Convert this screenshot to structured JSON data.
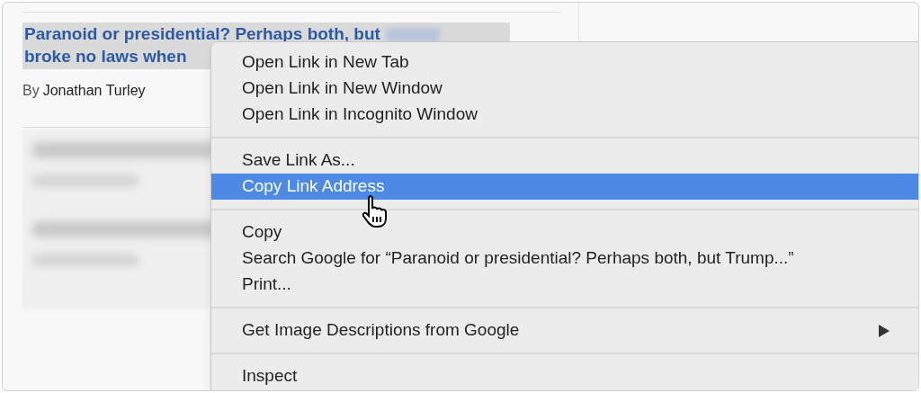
{
  "article": {
    "headline_lines": [
      "Paranoid or presidential? Perhaps both, but",
      "broke no laws when"
    ],
    "byline_prefix": "By",
    "author": "Jonathan Turley"
  },
  "context_menu": {
    "groups": [
      [
        {
          "label": "Open Link in New Tab",
          "selected": false,
          "submenu": false
        },
        {
          "label": "Open Link in New Window",
          "selected": false,
          "submenu": false
        },
        {
          "label": "Open Link in Incognito Window",
          "selected": false,
          "submenu": false
        }
      ],
      [
        {
          "label": "Save Link As...",
          "selected": false,
          "submenu": false
        },
        {
          "label": "Copy Link Address",
          "selected": true,
          "submenu": false
        }
      ],
      [
        {
          "label": "Copy",
          "selected": false,
          "submenu": false
        },
        {
          "label": "Search Google for “Paranoid or presidential? Perhaps both, but Trump...”",
          "selected": false,
          "submenu": false
        },
        {
          "label": "Print...",
          "selected": false,
          "submenu": false
        }
      ],
      [
        {
          "label": "Get Image Descriptions from Google",
          "selected": false,
          "submenu": true
        }
      ],
      [
        {
          "label": "Inspect",
          "selected": false,
          "submenu": false
        }
      ]
    ]
  }
}
